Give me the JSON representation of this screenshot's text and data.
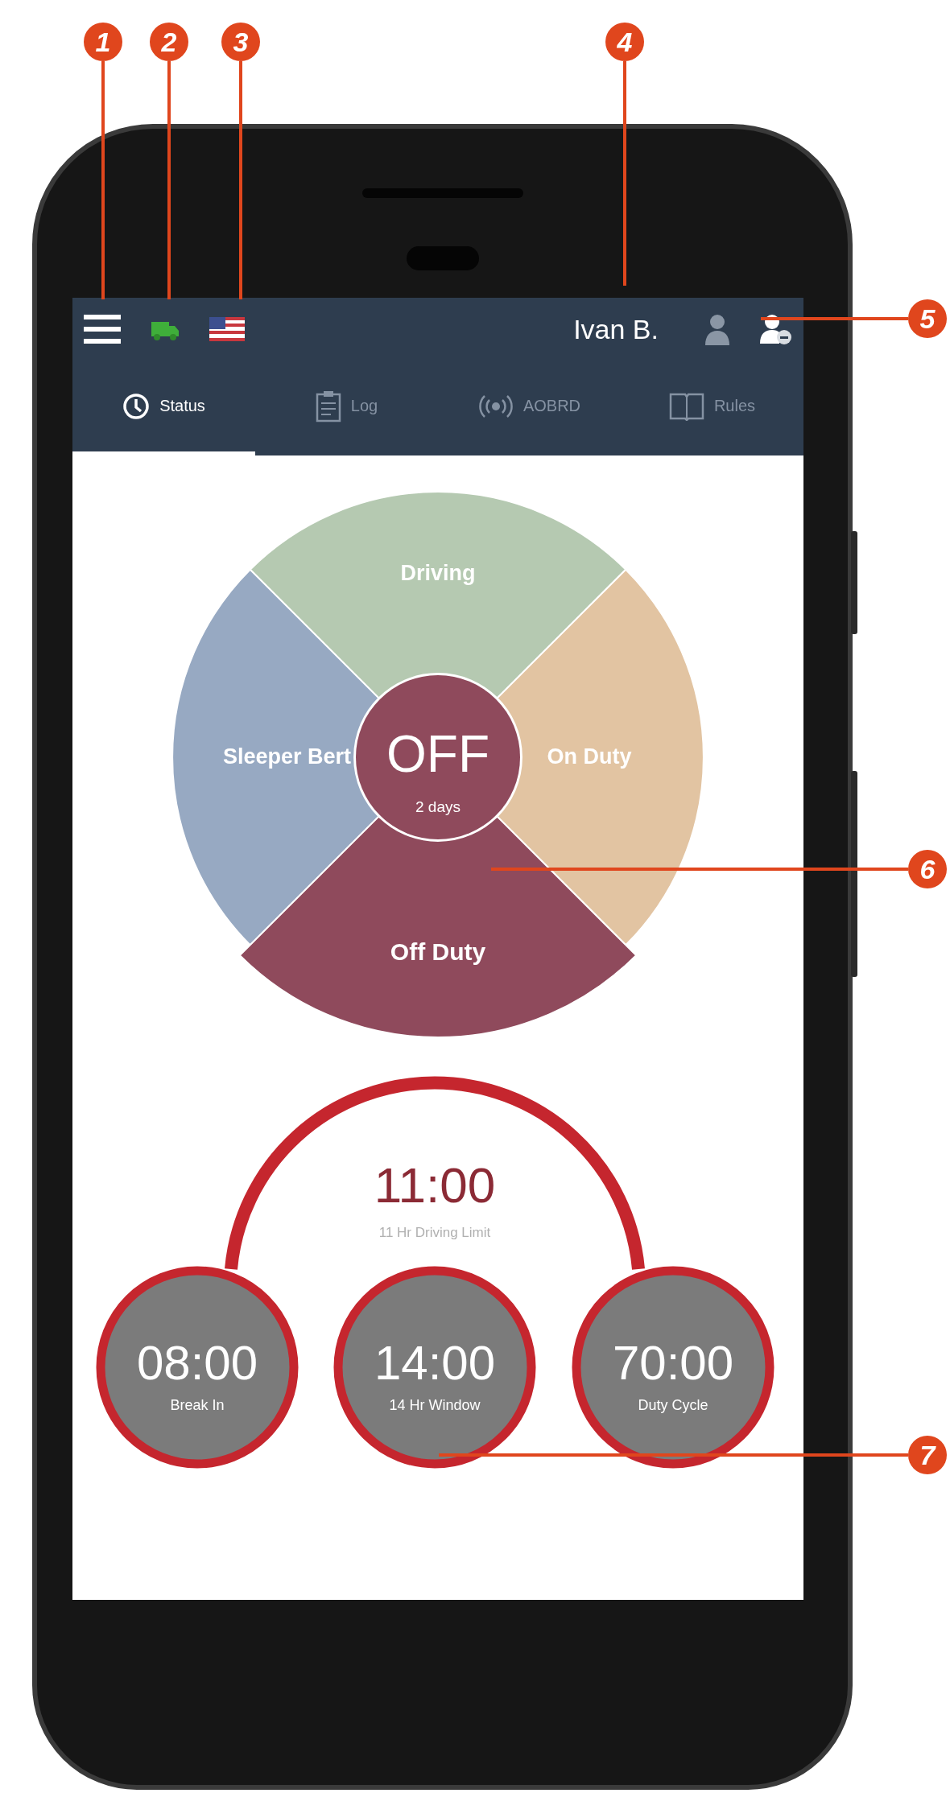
{
  "annotations": [
    {
      "number": "1"
    },
    {
      "number": "2"
    },
    {
      "number": "3"
    },
    {
      "number": "4"
    },
    {
      "number": "5"
    },
    {
      "number": "6"
    },
    {
      "number": "7"
    }
  ],
  "header": {
    "user_name": "Ivan B."
  },
  "tabs": [
    {
      "label": "Status",
      "selected": true
    },
    {
      "label": "Log",
      "selected": false
    },
    {
      "label": "AOBRD",
      "selected": false
    },
    {
      "label": "Rules",
      "selected": false
    }
  ],
  "status_wheel": {
    "segments": [
      {
        "label": "Driving",
        "color": "#b5c9b1",
        "selected": false
      },
      {
        "label": "Sleeper Bert",
        "color": "#97a9c2",
        "selected": false
      },
      {
        "label": "On Duty",
        "color": "#e2c4a2",
        "selected": false
      },
      {
        "label": "Off Duty",
        "color": "#8f4a5c",
        "selected": true
      }
    ],
    "current_status": "OFF",
    "duration": "2 days"
  },
  "timers": {
    "main": {
      "value": "11:00",
      "label": "11 Hr Driving Limit"
    },
    "items": [
      {
        "value": "08:00",
        "label": "Break In"
      },
      {
        "value": "14:00",
        "label": "14 Hr Window"
      },
      {
        "value": "70:00",
        "label": "Duty Cycle"
      }
    ]
  }
}
